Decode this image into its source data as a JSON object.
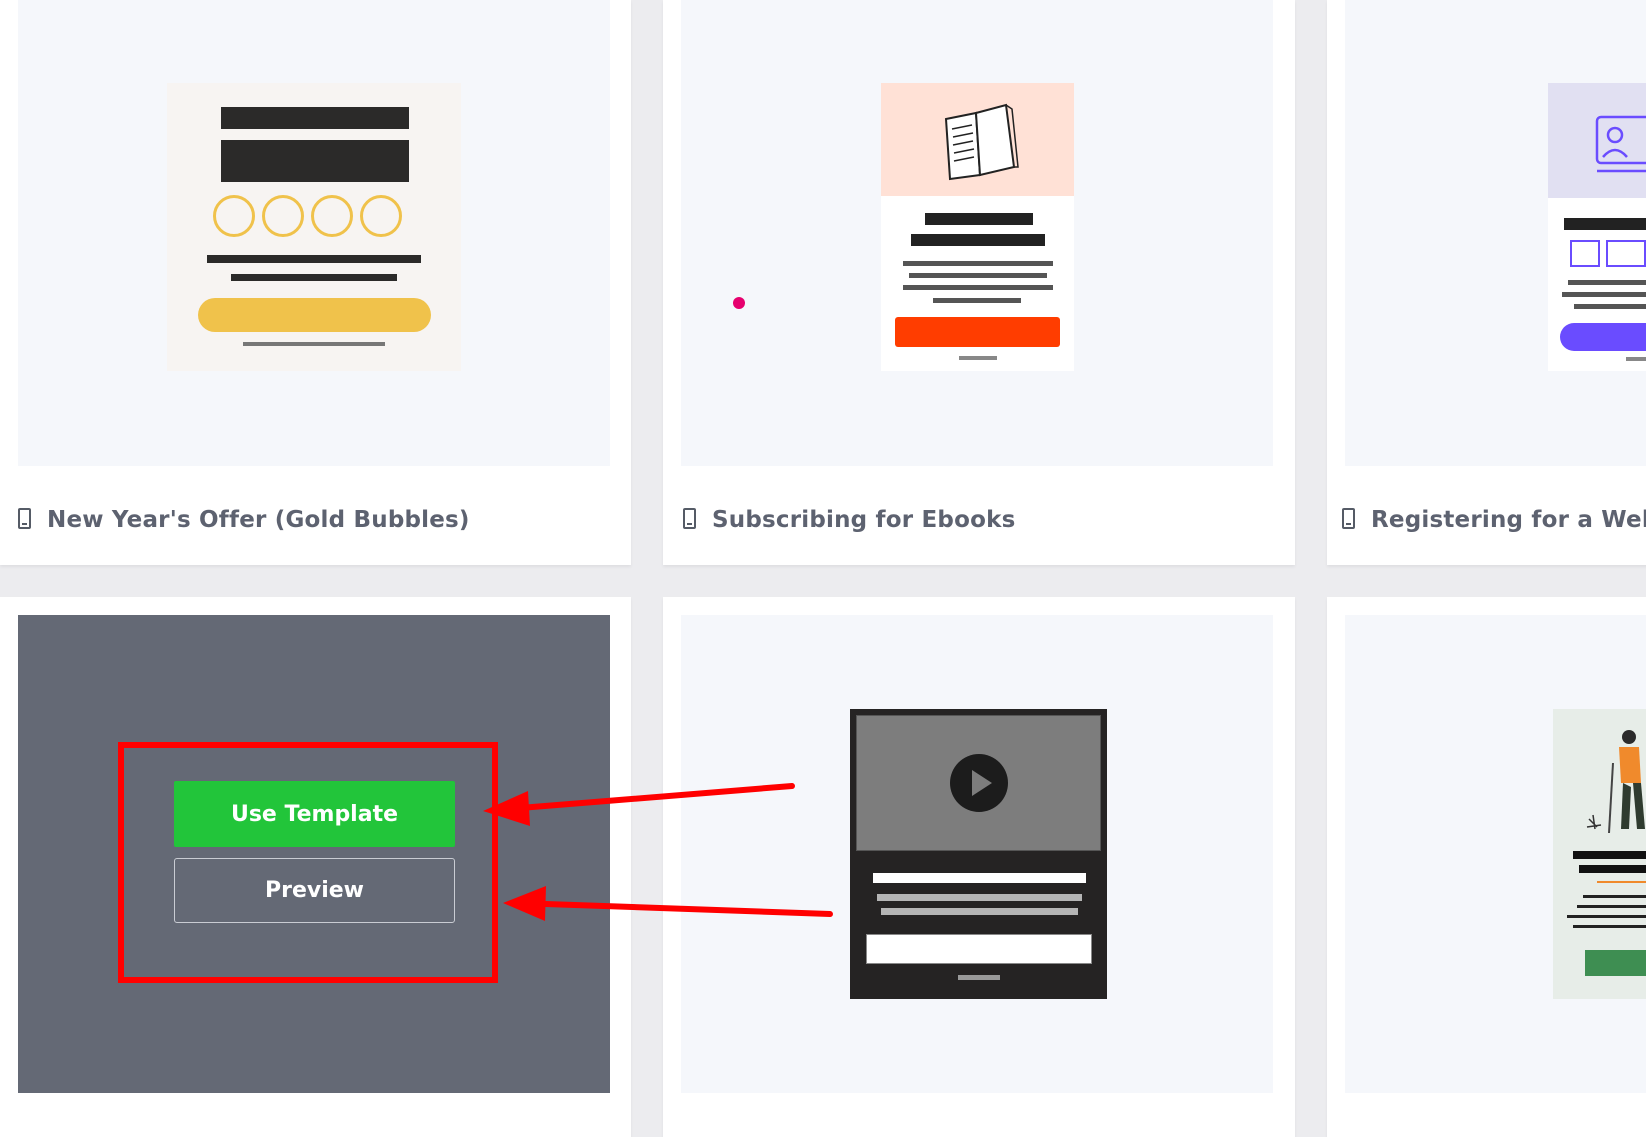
{
  "templates": [
    {
      "title": "New Year's Offer (Gold Bubbles)",
      "device_icon": "mobile-icon"
    },
    {
      "title": "Subscribing for Ebooks",
      "device_icon": "mobile-icon"
    },
    {
      "title": "Registering for a Web",
      "device_icon": "mobile-icon"
    }
  ],
  "hover_overlay": {
    "use_template_label": "Use Template",
    "preview_label": "Preview"
  },
  "colors": {
    "page_bg": "#ececef",
    "card_bg": "#ffffff",
    "thumb_bg": "#f5f7fb",
    "overlay_bg": "#646975",
    "use_template_green": "#22c53a",
    "annotation_red": "#ff0000",
    "gold": "#f0c24b",
    "ebook_orange": "#ff3d00",
    "webinar_purple": "#6a4cff"
  }
}
